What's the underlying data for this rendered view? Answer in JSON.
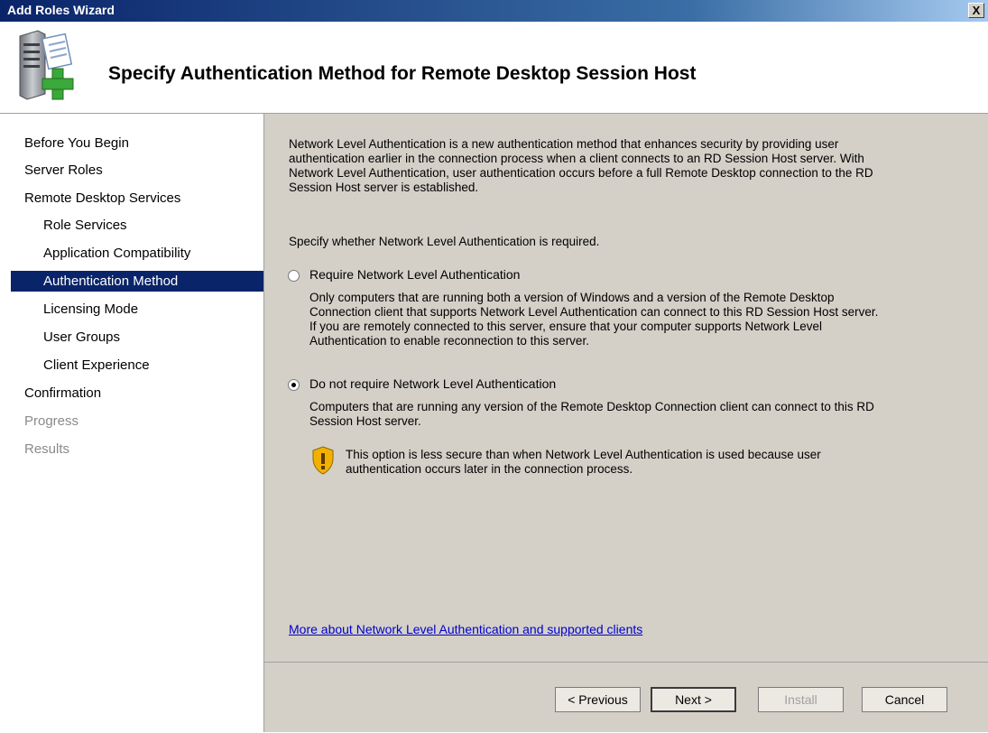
{
  "window": {
    "title": "Add Roles Wizard",
    "close_glyph": "X"
  },
  "header": {
    "title": "Specify Authentication Method for Remote Desktop Session Host",
    "icon": "server-add-icon"
  },
  "nav": {
    "items": [
      {
        "label": "Before You Begin",
        "level": 1,
        "state": "normal"
      },
      {
        "label": "Server Roles",
        "level": 1,
        "state": "normal"
      },
      {
        "label": "Remote Desktop Services",
        "level": 1,
        "state": "normal"
      },
      {
        "label": "Role Services",
        "level": 2,
        "state": "normal"
      },
      {
        "label": "Application Compatibility",
        "level": 2,
        "state": "normal"
      },
      {
        "label": "Authentication Method",
        "level": 2,
        "state": "active"
      },
      {
        "label": "Licensing Mode",
        "level": 2,
        "state": "normal"
      },
      {
        "label": "User Groups",
        "level": 2,
        "state": "normal"
      },
      {
        "label": "Client Experience",
        "level": 2,
        "state": "normal"
      },
      {
        "label": "Confirmation",
        "level": 1,
        "state": "normal"
      },
      {
        "label": "Progress",
        "level": 1,
        "state": "disabled"
      },
      {
        "label": "Results",
        "level": 1,
        "state": "disabled"
      }
    ]
  },
  "content": {
    "intro_lines": [
      "Network Level Authentication is a new authentication method that enhances security by providing user",
      "authentication earlier in the connection process when a client connects to an RD Session Host server. With",
      "Network Level Authentication, user authentication occurs before a full Remote Desktop connection to the RD",
      "Session Host server is established."
    ],
    "prompt": "Specify whether Network Level Authentication is required.",
    "option_require": {
      "label": "Require Network Level Authentication",
      "checked": false,
      "desc_lines": [
        "Only computers that are running both a version of Windows and a version of the Remote Desktop",
        "Connection client that supports Network Level Authentication can connect to this RD Session Host server.",
        "If you are remotely connected to this server, ensure that your computer supports Network Level",
        "Authentication to enable reconnection to this server."
      ]
    },
    "option_not_require": {
      "label": "Do not require Network Level Authentication",
      "checked": true,
      "desc_lines": [
        "Computers that are running any version of the Remote Desktop Connection client can connect to this RD",
        "Session Host server."
      ],
      "warning_icon": "security-warning-shield-icon",
      "warning_lines": [
        "This option is less secure than when Network Level Authentication is used because user",
        "authentication occurs later in the connection process."
      ]
    },
    "help_link": "More about Network Level Authentication and supported clients"
  },
  "buttons": {
    "previous": "< Previous",
    "next": "Next >",
    "install": "Install",
    "cancel": "Cancel"
  },
  "colors": {
    "selection": "#0a246a",
    "link": "#0000cc",
    "disabled_text": "#8a8a8a"
  }
}
